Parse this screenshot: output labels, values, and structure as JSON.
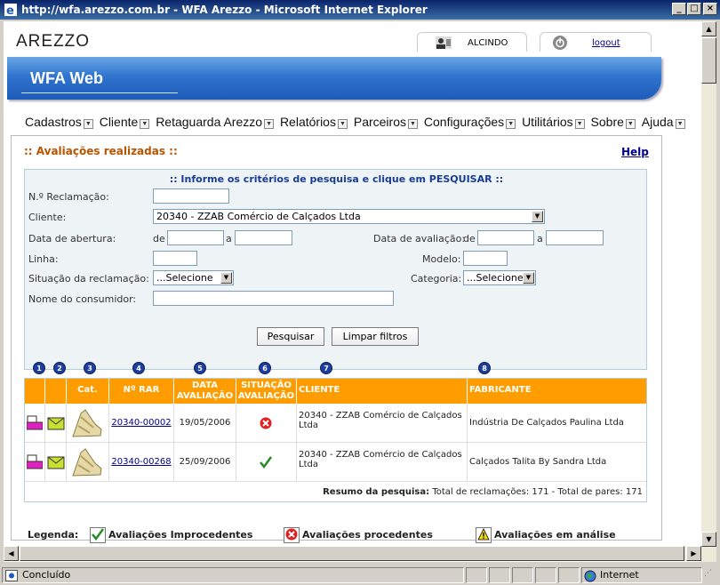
{
  "window": {
    "title": "http://wfa.arezzo.com.br - WFA Arezzo - Microsoft Internet Explorer"
  },
  "header": {
    "logo": "AREZZO",
    "user": "ALCINDO",
    "logout": "logout",
    "app_title": "WFA Web"
  },
  "menu": [
    "Cadastros",
    "Cliente",
    "Retaguarda Arezzo",
    "Relatórios",
    "Parceiros",
    "Configurações",
    "Utilitários",
    "Sobre",
    "Ajuda"
  ],
  "page": {
    "title": ":: Avaliações realizadas ::",
    "help": "Help"
  },
  "filters": {
    "heading": ":: Informe os critérios de pesquisa e clique em PESQUISAR ::",
    "reclamacao_label": "N.º Reclamação:",
    "cliente_label": "Cliente:",
    "cliente_value": "20340 - ZZAB Comércio de Calçados Ltda",
    "abertura_label": "Data de abertura:",
    "avaliacao_label": "Data de avaliação:",
    "de": "de",
    "a": "a",
    "linha_label": "Linha:",
    "modelo_label": "Modelo:",
    "situacao_label": "Situação da reclamação:",
    "situacao_value": "...Selecione",
    "categoria_label": "Categoria:",
    "categoria_value": "...Selecione",
    "consumidor_label": "Nome do consumidor:",
    "search_button": "Pesquisar",
    "clear_button": "Limpar filtros"
  },
  "column_numbers": [
    "1",
    "2",
    "3",
    "4",
    "5",
    "6",
    "7",
    "8"
  ],
  "table": {
    "headers": {
      "cat": "Cat.",
      "rar": "Nº RAR",
      "data": "DATA AVALIAÇÃO",
      "situacao": "SITUAÇÃO AVALIAÇÃO",
      "cliente": "CLIENTE",
      "fabricante": "FABRICANTE"
    },
    "rows": [
      {
        "rar": "20340-00002",
        "data": "19/05/2006",
        "status": "procedente",
        "cliente": "20340 - ZZAB Comércio de Calçados Ltda",
        "fabricante": "Indústria De Calçados Paulina Ltda"
      },
      {
        "rar": "20340-00268",
        "data": "25/09/2006",
        "status": "improcedente",
        "cliente": "20340 - ZZAB Comércio de Calçados Ltda",
        "fabricante": "Calçados Talita By Sandra Ltda"
      }
    ],
    "summary_label": "Resumo da pesquisa:",
    "summary_text": "Total de reclamações: 171 - Total de pares: 171"
  },
  "legend": {
    "label": "Legenda:",
    "improcedentes": "Avaliações Improcedentes",
    "procedentes": "Avaliações procedentes",
    "analise": "Avaliações em análise"
  },
  "statusbar": {
    "status": "Concluído",
    "zone": "Internet"
  },
  "colors": {
    "orange": "#ff9d00",
    "blue_banner": "#2f74cf",
    "title_orange": "#b85400"
  }
}
